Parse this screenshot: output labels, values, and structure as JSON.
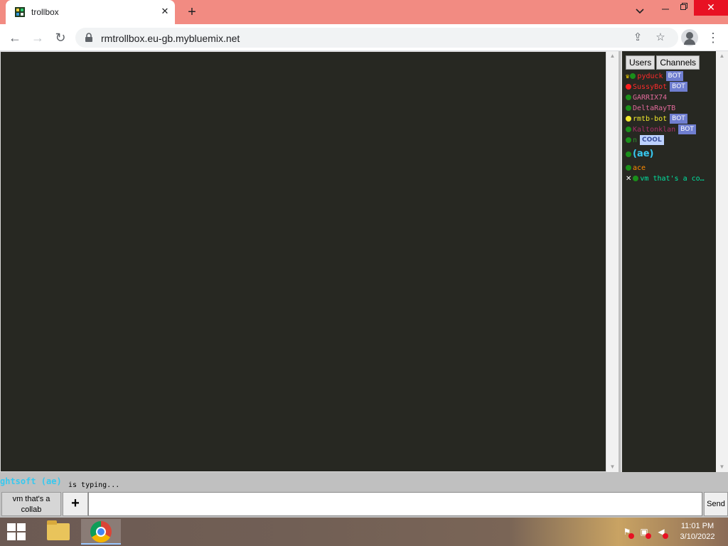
{
  "browser": {
    "tab_title": "trollbox",
    "url": "rmtrollbox.eu-gb.mybluemix.net"
  },
  "sidebar": {
    "tabs": [
      {
        "label": "Users"
      },
      {
        "label": "Channels"
      }
    ],
    "users": [
      {
        "name": "pyduck",
        "name_color": "#ff2a2a",
        "dot_color": "#1a8f1a",
        "crown": true,
        "badge": "BOT"
      },
      {
        "name": "SussyBot",
        "name_color": "#ff2a2a",
        "dot_color": "#ff2020",
        "badge": "BOT"
      },
      {
        "name": "GARRIX74",
        "name_color": "#e06a9a",
        "dot_color": "#1a8f1a"
      },
      {
        "name": "DeltaRayTB",
        "name_color": "#e06a9a",
        "dot_color": "#1a8f1a"
      },
      {
        "name": "rmtb-bot",
        "name_color": "#f1e92c",
        "dot_color": "#f1e92c",
        "badge": "BOT"
      },
      {
        "name": "Kaltonklan",
        "name_color": "#a8306a",
        "dot_color": "#1a8f1a",
        "badge": "BOT"
      },
      {
        "name": "n",
        "name_color": "#2e8b2e",
        "dot_color": "#1a8f1a",
        "badge": "COOL"
      },
      {
        "name": "(ae)",
        "name_color": "#37c8ef",
        "dot_color": "#1a8f1a"
      },
      {
        "name": "ace",
        "name_color": "#ff8c00",
        "dot_color": "#1a8f1a"
      },
      {
        "name": "vm that's a co…",
        "name_color": "#00e2a0",
        "dot_color": "#1a8f1a",
        "muted": true
      }
    ]
  },
  "chat": {
    "typing_name": "ghtsoft (ae)",
    "typing_text": "is typing...",
    "channel_button": "vm that's a collab",
    "plus_label": "+",
    "send_label": "Send",
    "input_value": ""
  },
  "taskbar": {
    "time": "11:01 PM",
    "date": "3/10/2022"
  }
}
